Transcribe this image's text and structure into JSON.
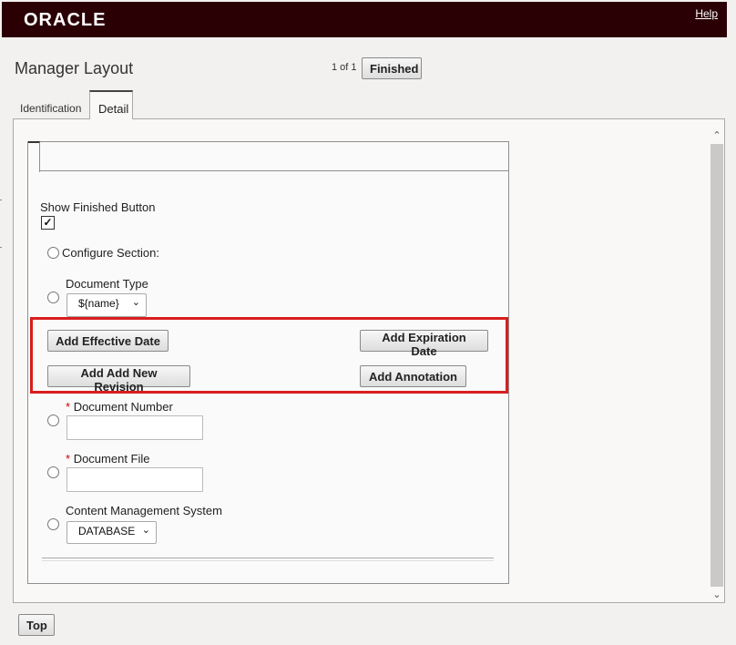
{
  "header": {
    "logo_text": "ORACLE",
    "help_link": "Help",
    "brand_color": "#2b0005"
  },
  "page": {
    "title": "Manager Layout",
    "pager_text": "1 of 1",
    "finished_button": "Finished"
  },
  "tabs": [
    {
      "label": "Identification",
      "active": false
    },
    {
      "label": "Detail",
      "active": true
    }
  ],
  "form": {
    "show_finished_label": "Show Finished Button",
    "show_finished_checked": true,
    "configure_section_label": "Configure Section:",
    "document_type_label": "Document Type",
    "document_type_value": "${name}",
    "buttons": {
      "add_effective_date": "Add Effective Date",
      "add_expiration_date": "Add Expiration Date",
      "add_new_revision": "Add Add New Revision",
      "add_annotation": "Add Annotation"
    },
    "document_number_label": "Document Number",
    "document_file_label": "Document File",
    "required_marker": "*",
    "cms_label": "Content Management System",
    "cms_value": "DATABASE",
    "highlight_color": "#d81e1e"
  },
  "footer": {
    "top_button": "Top"
  }
}
